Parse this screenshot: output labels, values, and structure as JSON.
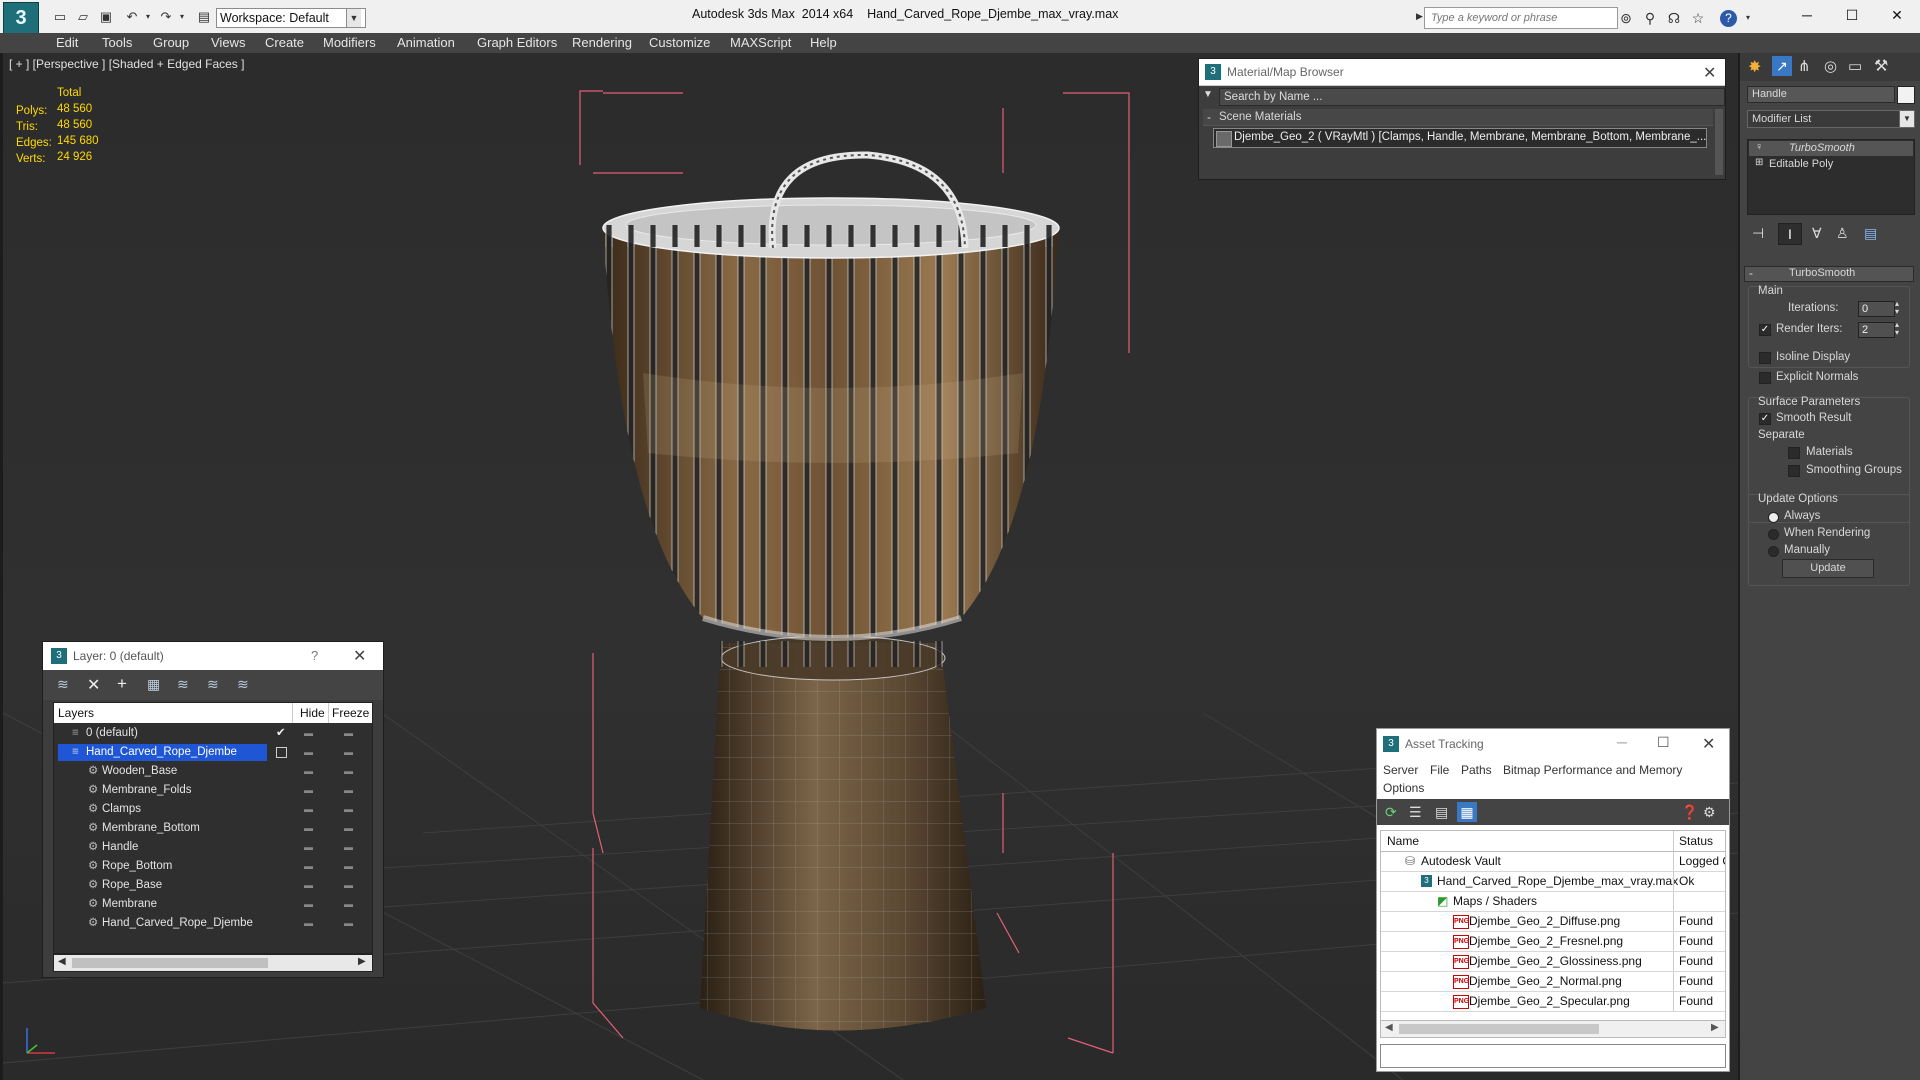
{
  "titlebar": {
    "app_title": "Autodesk 3ds Max  2014 x64",
    "file_name": "Hand_Carved_Rope_Djembe_max_vray.max",
    "workspace": "Workspace: Default",
    "search_placeholder": "Type a keyword or phrase",
    "logo_glyph": "3",
    "minimize": "─",
    "maximize": "☐",
    "close": "✕"
  },
  "menu": [
    "Edit",
    "Tools",
    "Group",
    "Views",
    "Create",
    "Modifiers",
    "Animation",
    "Graph Editors",
    "Rendering",
    "Customize",
    "MAXScript",
    "Help"
  ],
  "viewport": {
    "label": "[ + ] [Perspective ] [Shaded + Edged Faces ]",
    "stats_header": "Total",
    "stats": [
      {
        "label": "Polys:",
        "value": "48 560"
      },
      {
        "label": "Tris:",
        "value": "48 560"
      },
      {
        "label": "Edges:",
        "value": "145 680"
      },
      {
        "label": "Verts:",
        "value": "24 926"
      }
    ]
  },
  "layer_panel": {
    "title": "Layer: 0 (default)",
    "help": "?",
    "columns": {
      "layers": "Layers",
      "hide": "Hide",
      "freeze": "Freeze"
    },
    "rows": [
      {
        "name": "0 (default)",
        "level": 1,
        "selected": false
      },
      {
        "name": "Hand_Carved_Rope_Djembe",
        "level": 1,
        "selected": true
      },
      {
        "name": "Wooden_Base",
        "level": 2,
        "selected": false
      },
      {
        "name": "Membrane_Folds",
        "level": 2,
        "selected": false
      },
      {
        "name": "Clamps",
        "level": 2,
        "selected": false
      },
      {
        "name": "Membrane_Bottom",
        "level": 2,
        "selected": false
      },
      {
        "name": "Handle",
        "level": 2,
        "selected": false
      },
      {
        "name": "Rope_Bottom",
        "level": 2,
        "selected": false
      },
      {
        "name": "Rope_Base",
        "level": 2,
        "selected": false
      },
      {
        "name": "Membrane",
        "level": 2,
        "selected": false
      },
      {
        "name": "Hand_Carved_Rope_Djembe",
        "level": 2,
        "selected": false
      }
    ]
  },
  "material_browser": {
    "title": "Material/Map Browser",
    "search_placeholder": "Search by Name ...",
    "section": "Scene Materials",
    "item": "Djembe_Geo_2  ( VRayMtl )  [Clamps, Handle, Membrane, Membrane_Bottom, Membrane_..."
  },
  "command_panel": {
    "object_name": "Handle",
    "modifier_list": "Modifier List",
    "stack": [
      "TurboSmooth",
      "Editable Poly"
    ],
    "rollout_title": "TurboSmooth",
    "main_label": "Main",
    "iterations_label": "Iterations:",
    "iterations_value": "0",
    "render_iters_label": "Render Iters:",
    "render_iters_value": "2",
    "isoline": "Isoline Display",
    "explicit_normals": "Explicit Normals",
    "surface_params": "Surface Parameters",
    "smooth_result": "Smooth Result",
    "separate": "Separate",
    "materials": "Materials",
    "smoothing_groups": "Smoothing Groups",
    "update_options": "Update Options",
    "always": "Always",
    "when_rendering": "When Rendering",
    "manually": "Manually",
    "update_button": "Update"
  },
  "asset_tracking": {
    "title": "Asset Tracking",
    "menu": [
      "Server",
      "File",
      "Paths",
      "Bitmap Performance and Memory",
      "Options"
    ],
    "columns": {
      "name": "Name",
      "status": "Status"
    },
    "rows": [
      {
        "name": "Autodesk Vault",
        "status": "Logged O",
        "indent": 1,
        "icon": "vault"
      },
      {
        "name": "Hand_Carved_Rope_Djembe_max_vray.max",
        "status": "Ok",
        "indent": 2,
        "icon": "max"
      },
      {
        "name": "Maps / Shaders",
        "status": "",
        "indent": 3,
        "icon": "maps"
      },
      {
        "name": "Djembe_Geo_2_Diffuse.png",
        "status": "Found",
        "indent": 4,
        "icon": "png"
      },
      {
        "name": "Djembe_Geo_2_Fresnel.png",
        "status": "Found",
        "indent": 4,
        "icon": "png"
      },
      {
        "name": "Djembe_Geo_2_Glossiness.png",
        "status": "Found",
        "indent": 4,
        "icon": "png"
      },
      {
        "name": "Djembe_Geo_2_Normal.png",
        "status": "Found",
        "indent": 4,
        "icon": "png"
      },
      {
        "name": "Djembe_Geo_2_Specular.png",
        "status": "Found",
        "indent": 4,
        "icon": "png"
      }
    ]
  },
  "colors": {
    "selection": "#1e56d6",
    "stats": "#ffd800",
    "bbox": "#e0607a",
    "ui_dark": "#3d3d3d"
  }
}
